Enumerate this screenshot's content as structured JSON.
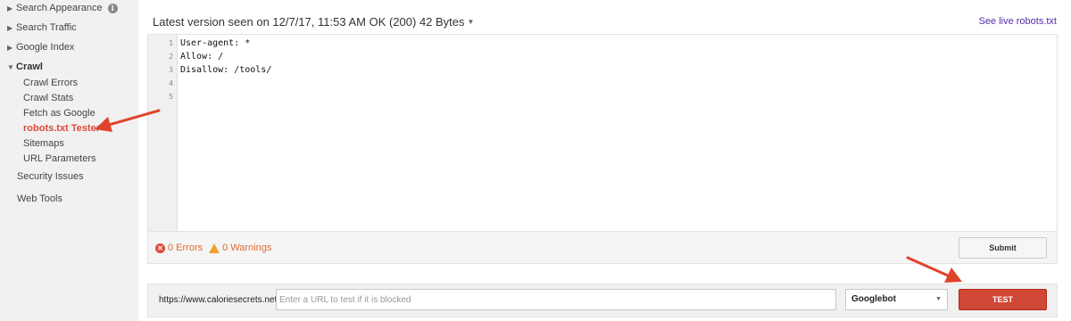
{
  "sidebar": {
    "items": [
      {
        "label": "Search Appearance"
      },
      {
        "label": "Search Traffic"
      },
      {
        "label": "Google Index"
      },
      {
        "label": "Crawl"
      }
    ],
    "crawl_children": [
      {
        "label": "Crawl Errors"
      },
      {
        "label": "Crawl Stats"
      },
      {
        "label": "Fetch as Google"
      },
      {
        "label": "robots.txt Tester"
      },
      {
        "label": "Sitemaps"
      },
      {
        "label": "URL Parameters"
      }
    ],
    "bottom_items": [
      {
        "label": "Security Issues"
      },
      {
        "label": "Web Tools"
      }
    ],
    "info_icon": "i"
  },
  "header": {
    "title": "Latest version seen on 12/7/17, 11:53 AM OK (200) 42 Bytes",
    "live_link": "See live robots.txt"
  },
  "editor": {
    "line_numbers": [
      "1",
      "2",
      "3",
      "4",
      "5"
    ],
    "lines": [
      "User-agent: *",
      "Allow: /",
      "Disallow: /tools/",
      "",
      ""
    ]
  },
  "status": {
    "errors": "0 Errors",
    "warnings": "0 Warnings",
    "submit_label": "Submit"
  },
  "test_bar": {
    "url_prefix": "https://www.caloriesecrets.net/",
    "url_placeholder": "Enter a URL to test if it is blocked",
    "user_agent": "Googlebot",
    "test_label": "TEST"
  },
  "colors": {
    "accent_red": "#dd4b39",
    "annotation_arrow": "#e0432b",
    "link_purple": "#5a2cad",
    "warning_orange": "#f0a030"
  },
  "icons": {
    "info": "info-icon",
    "error": "error-circle-icon",
    "warning": "warning-triangle-icon",
    "dropdown": "chevron-down-icon"
  }
}
